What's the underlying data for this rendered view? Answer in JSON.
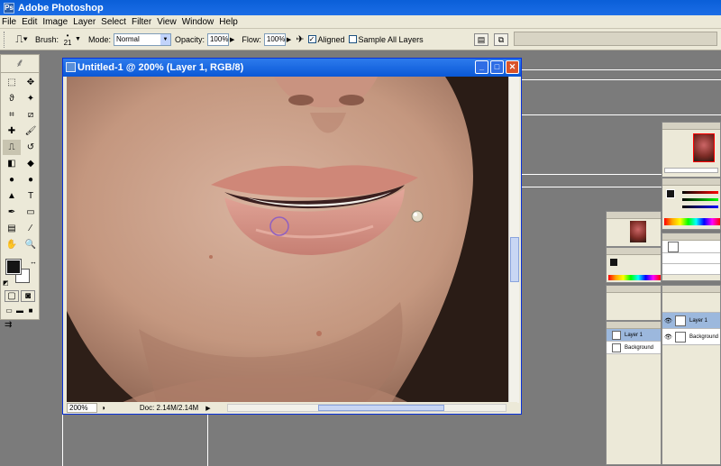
{
  "app": {
    "title": "Adobe Photoshop",
    "logo_text": "Ps"
  },
  "menu": [
    "File",
    "Edit",
    "Image",
    "Layer",
    "Select",
    "Filter",
    "View",
    "Window",
    "Help"
  ],
  "options_bar": {
    "brush_label": "Brush:",
    "brush_size": "21",
    "mode_label": "Mode:",
    "mode_value": "Normal",
    "opacity_label": "Opacity:",
    "opacity_value": "100%",
    "flow_label": "Flow:",
    "flow_value": "100%",
    "aligned_label": "Aligned",
    "aligned_checked": true,
    "sample_all_label": "Sample All Layers",
    "sample_all_checked": false
  },
  "document": {
    "title": "Untitled-1 @ 200% (Layer 1, RGB/8)",
    "zoom": "200%",
    "doc_info": "Doc: 2.14M/2.14M"
  },
  "colors": {
    "xp_title_blue": "#0a58d6",
    "xp_face": "#ece9d8",
    "workspace_gray": "#7b7b7b",
    "foreground": "#151515",
    "background": "#ffffff",
    "brush_cursor": "#9060c0"
  },
  "icons": {
    "tools": [
      "marquee-icon",
      "move-icon",
      "lasso-icon",
      "magic-wand-icon",
      "crop-icon",
      "slice-icon",
      "healing-brush-icon",
      "brush-icon",
      "clone-stamp-icon",
      "history-brush-icon",
      "eraser-icon",
      "paint-bucket-icon",
      "blur-icon",
      "dodge-icon",
      "path-select-icon",
      "type-icon",
      "pen-icon",
      "shape-icon",
      "notes-icon",
      "eyedropper-icon",
      "hand-icon",
      "zoom-icon"
    ],
    "tool_glyphs": [
      "⬚",
      "✥",
      "ϑ",
      "✦",
      "⌗",
      "⧄",
      "✚",
      "🖌",
      "⎍",
      "↺",
      "◧",
      "◆",
      "●",
      "●",
      "▲",
      "T",
      "✒",
      "▭",
      "▤",
      "⁄",
      "✋",
      "🔍"
    ]
  },
  "layers_right": {
    "layer1": "Layer 1",
    "background": "Background"
  },
  "layers_mid": {
    "layer1": "Layer 1",
    "background": "Background"
  }
}
